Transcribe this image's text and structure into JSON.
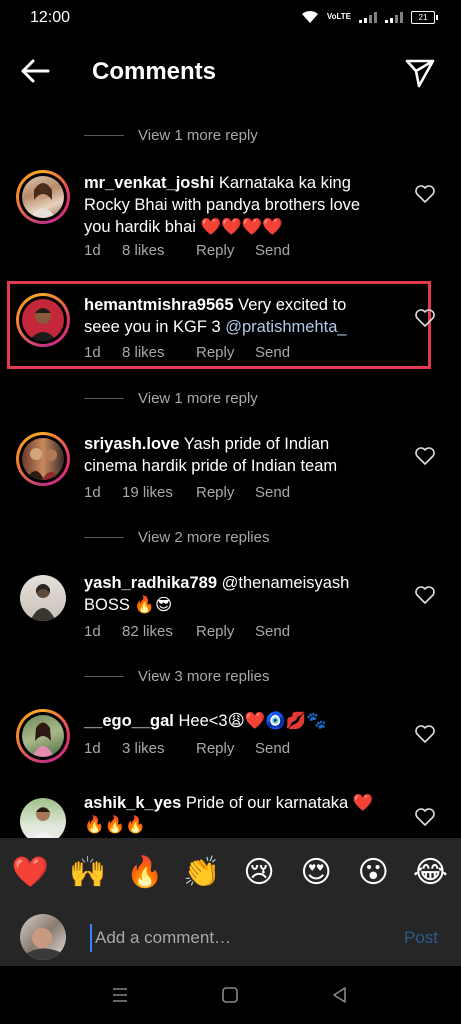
{
  "status": {
    "time": "12:00",
    "network": "VoLTE",
    "battery": "21"
  },
  "header": {
    "title": "Comments",
    "back_icon": "arrow-left-icon",
    "send_icon": "paper-plane-icon"
  },
  "view_more": [
    {
      "label": "View 1 more reply"
    },
    {
      "label": "View 1 more reply"
    },
    {
      "label": "View 2 more replies"
    },
    {
      "label": "View 3 more replies"
    }
  ],
  "comments": [
    {
      "username": "mr_venkat_joshi",
      "text": "Karnataka ka king Rocky Bhai with pandya brothers love you hardik bhai ❤️❤️❤️❤️",
      "time": "1d",
      "likes": "8 likes",
      "reply": "Reply",
      "send": "Send",
      "avatar_ring": true
    },
    {
      "username": "hemantmishra9565",
      "text": "Very excited to seee you in KGF 3 ",
      "mention": "@pratishmehta_",
      "time": "1d",
      "likes": "8 likes",
      "reply": "Reply",
      "send": "Send",
      "avatar_ring": true,
      "highlighted": true
    },
    {
      "username": "sriyash.love",
      "text": "Yash pride of Indian cinema hardik pride of Indian team",
      "time": "1d",
      "likes": "19 likes",
      "reply": "Reply",
      "send": "Send",
      "avatar_ring": true
    },
    {
      "username": "yash_radhika789",
      "text": "@thenameisyash BOSS 🔥😎",
      "time": "1d",
      "likes": "82 likes",
      "reply": "Reply",
      "send": "Send",
      "avatar_ring": false
    },
    {
      "username": "__ego__gal",
      "text": "Hee<3😩❤️🧿💋🐾",
      "time": "1d",
      "likes": "3 likes",
      "reply": "Reply",
      "send": "Send",
      "avatar_ring": true
    },
    {
      "username": "ashik_k_yes",
      "text": "Pride of our karnataka ❤️🔥🔥🔥",
      "avatar_ring": false
    }
  ],
  "emoji_bar": [
    "❤️",
    "🙌",
    "🔥",
    "👏",
    "😢",
    "😍",
    "😮",
    "😂"
  ],
  "compose": {
    "placeholder": "Add a comment…",
    "post_label": "Post"
  },
  "colors": {
    "background": "#000000",
    "muted_text": "#a8a8a8",
    "highlight_box": "#e53950",
    "post_disabled": "#2b5c8f",
    "composer_bg": "#262626"
  }
}
